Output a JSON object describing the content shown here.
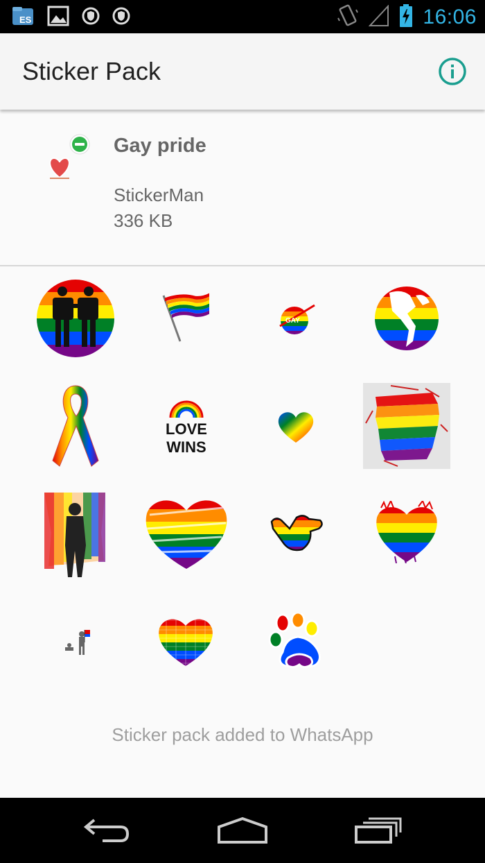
{
  "status_bar": {
    "time": "16:06",
    "left_icons": [
      "es-file-explorer-icon",
      "gallery-icon",
      "shield-icon",
      "shield-icon"
    ],
    "right_icons": [
      "vibrate-icon",
      "signal-icon",
      "battery-charging-icon"
    ],
    "accent_color": "#33b5e5"
  },
  "app_bar": {
    "title": "Sticker Pack",
    "info_icon": "info-icon",
    "info_color": "#1a9e8f"
  },
  "pack": {
    "name": "Gay pride",
    "publisher": "StickerMan",
    "size": "336 KB"
  },
  "stickers": [
    {
      "name": "couple-circle-sticker"
    },
    {
      "name": "rainbow-flag-sticker"
    },
    {
      "name": "gay-planet-sticker"
    },
    {
      "name": "rainbow-globe-sticker"
    },
    {
      "name": "rainbow-ribbon-sticker"
    },
    {
      "name": "love-wins-sticker",
      "text_line1": "LOVE",
      "text_line2": "WINS"
    },
    {
      "name": "small-rainbow-heart-sticker"
    },
    {
      "name": "torn-rainbow-flag-sticker"
    },
    {
      "name": "woman-with-flag-sticker"
    },
    {
      "name": "brushed-rainbow-heart-sticker"
    },
    {
      "name": "rainbow-hand-sticker"
    },
    {
      "name": "splatter-rainbow-heart-sticker"
    },
    {
      "name": "people-parade-sticker"
    },
    {
      "name": "mosaic-rainbow-heart-sticker"
    },
    {
      "name": "rainbow-paw-sticker"
    }
  ],
  "footer": {
    "added_text": "Sticker pack added to WhatsApp"
  },
  "nav_bar": {
    "buttons": [
      "back-icon",
      "home-icon",
      "recent-apps-icon"
    ]
  },
  "colors": {
    "rainbow": [
      "#e40303",
      "#ff8c00",
      "#ffed00",
      "#008026",
      "#004dff",
      "#750787"
    ]
  }
}
